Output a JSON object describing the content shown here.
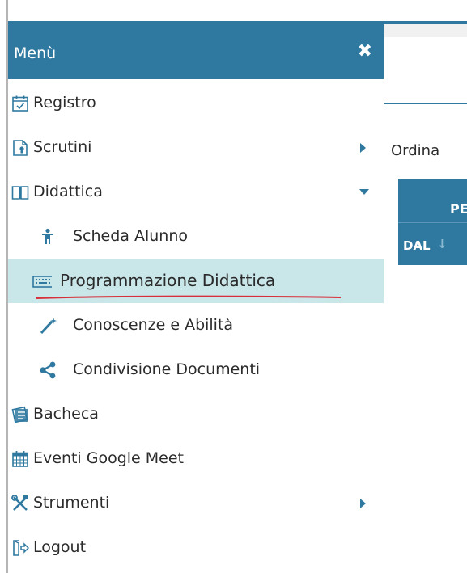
{
  "menu": {
    "title": "Menù",
    "close_icon": "close-icon",
    "items": [
      {
        "label": "Registro",
        "icon": "calendar-check-icon"
      },
      {
        "label": "Scrutini",
        "icon": "document-icon",
        "submenu": "collapsed"
      },
      {
        "label": "Didattica",
        "icon": "book-icon",
        "submenu": "expanded"
      },
      {
        "label": "Scheda Alunno",
        "icon": "student-icon"
      },
      {
        "label": "Programmazione Didattica",
        "icon": "keyboard-icon",
        "active": true
      },
      {
        "label": "Conoscenze e Abilità",
        "icon": "magic-wand-icon"
      },
      {
        "label": "Condivisione Documenti",
        "icon": "share-icon"
      },
      {
        "label": "Bacheca",
        "icon": "bulletin-board-icon"
      },
      {
        "label": "Eventi Google Meet",
        "icon": "calendar-icon"
      },
      {
        "label": "Strumenti",
        "icon": "tools-icon",
        "submenu": "collapsed"
      },
      {
        "label": "Logout",
        "icon": "logout-icon"
      }
    ]
  },
  "content": {
    "sort_label": "Ordina",
    "table": {
      "header_top": "PE",
      "header_col": "DAL"
    }
  },
  "colors": {
    "accent": "#2f79a0",
    "active_row": "#c9e6e9",
    "annotation": "#d8303a"
  }
}
